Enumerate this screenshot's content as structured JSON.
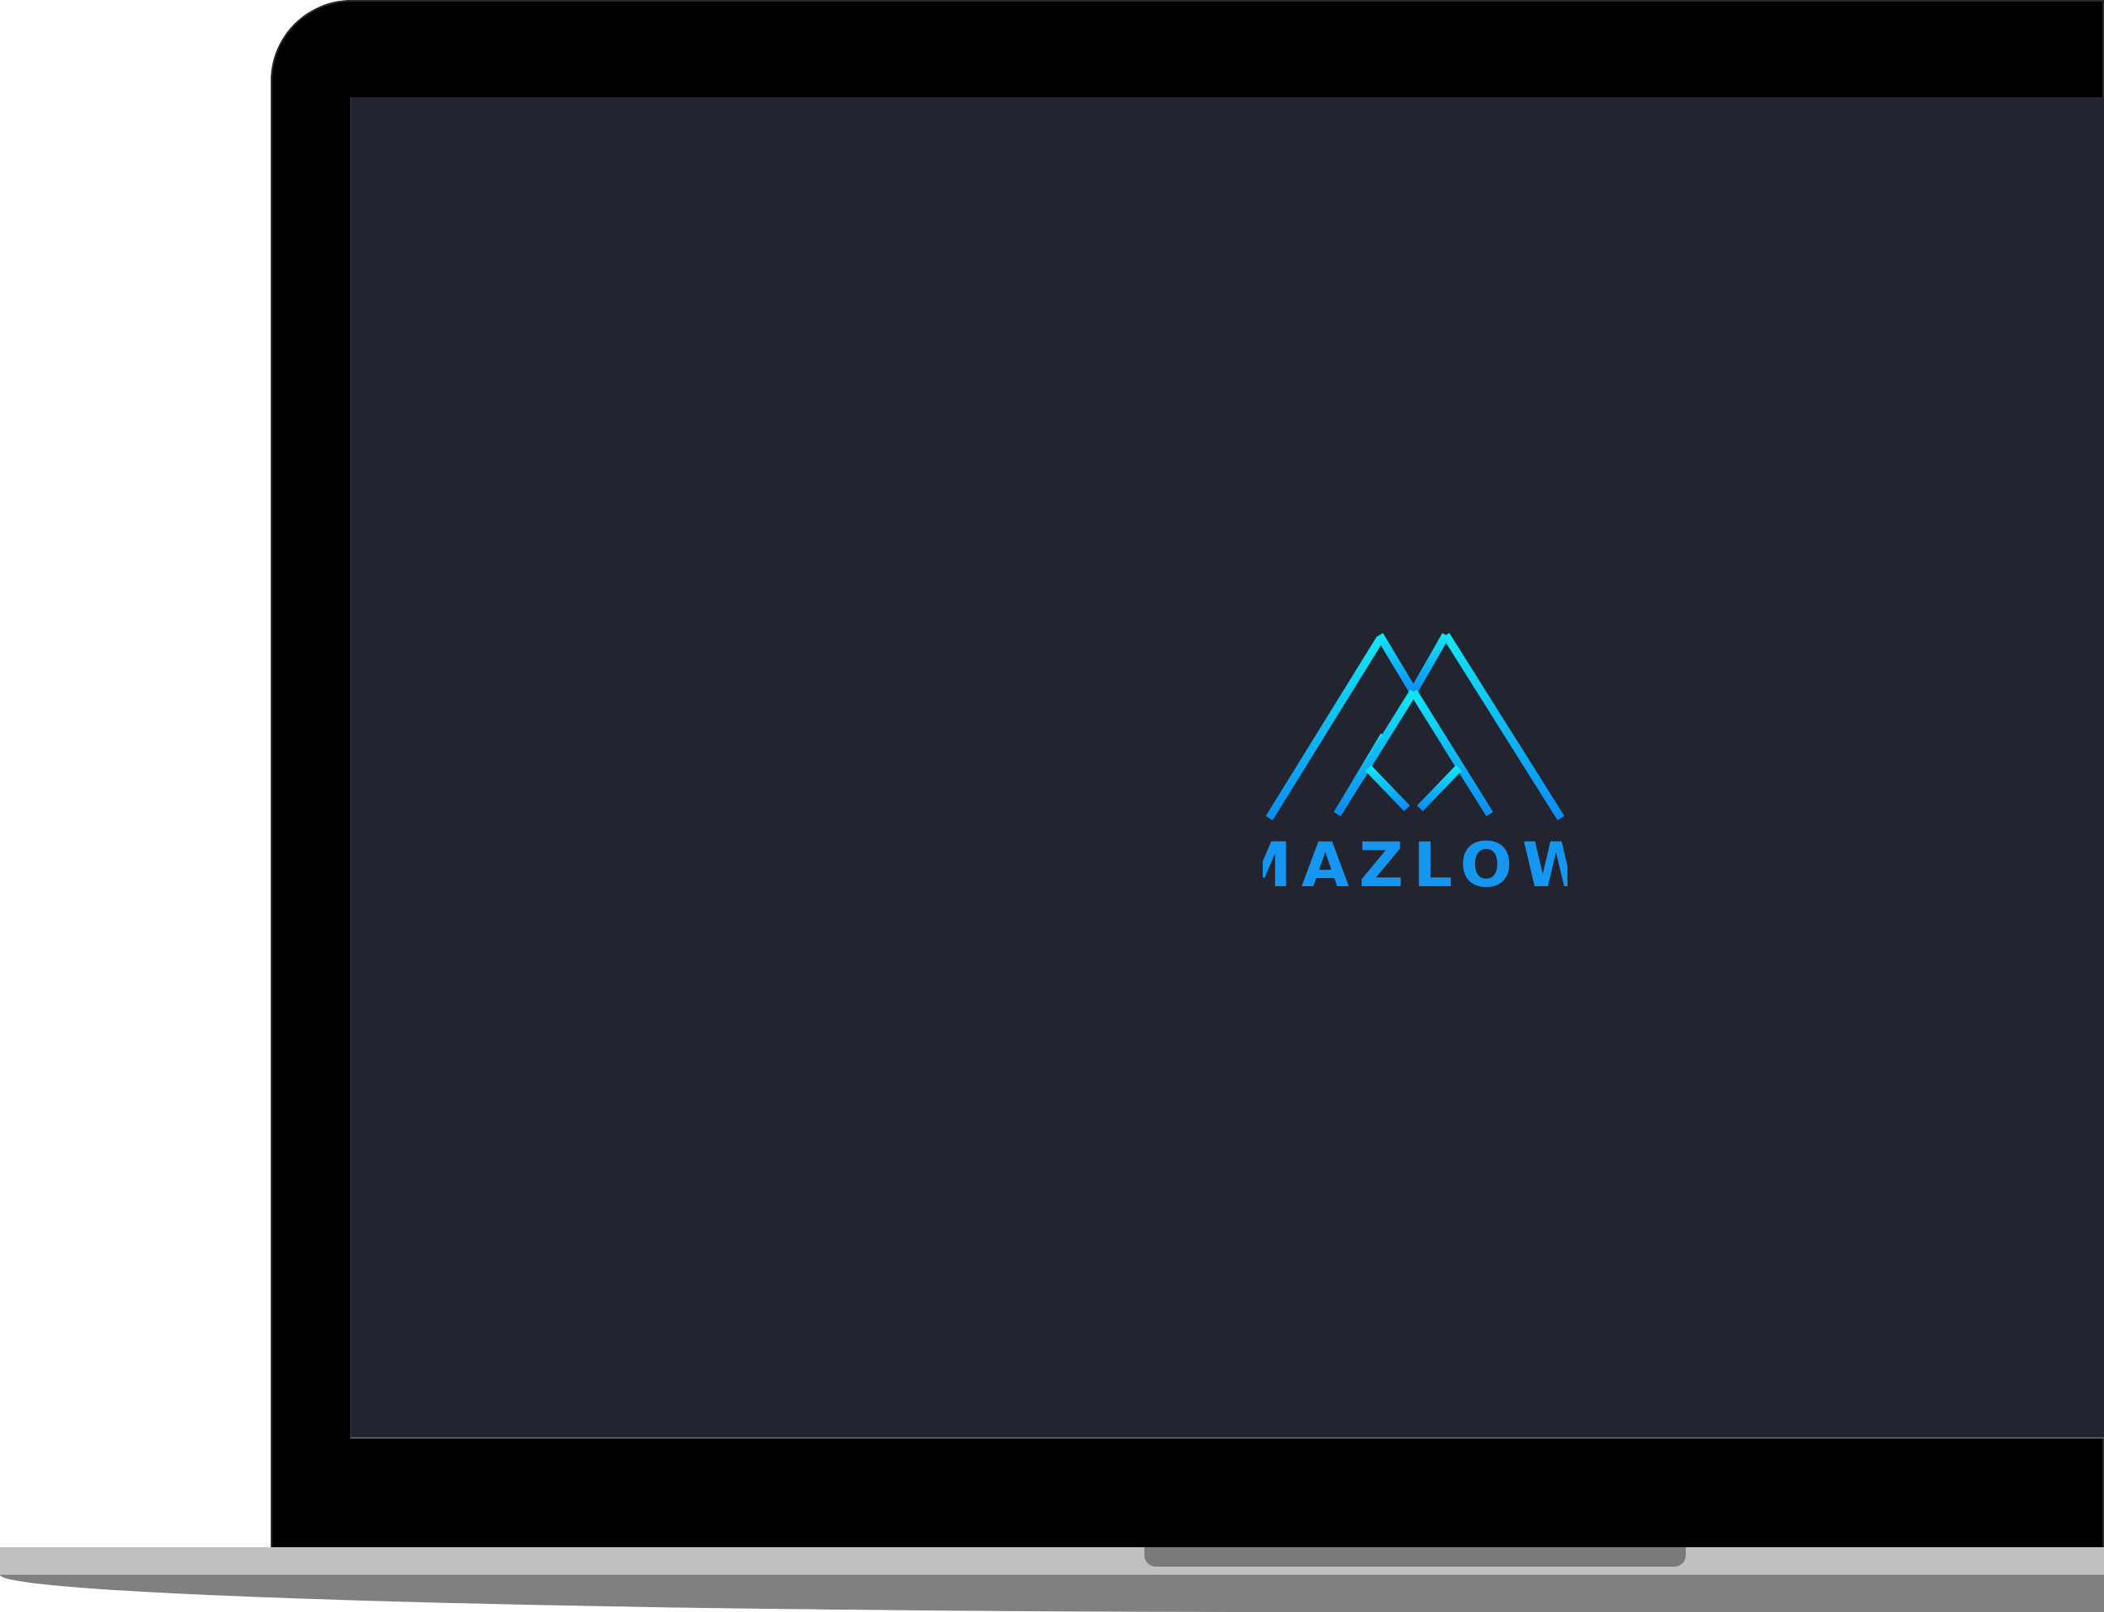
{
  "device": {
    "type": "laptop-mockup",
    "colors": {
      "bezel": "#000000",
      "screen": "#222430",
      "base_top": "#c0c0c0",
      "base_bottom": "#808080",
      "notch": "#7a7a7a"
    }
  },
  "splash": {
    "logo_icon": "mountain-peaks-logo-icon",
    "brand_name": "MAZLOW",
    "gradient": {
      "top": "#12e6f4",
      "bottom": "#0a8ef5"
    },
    "wordmark_color": "#1596f0"
  }
}
